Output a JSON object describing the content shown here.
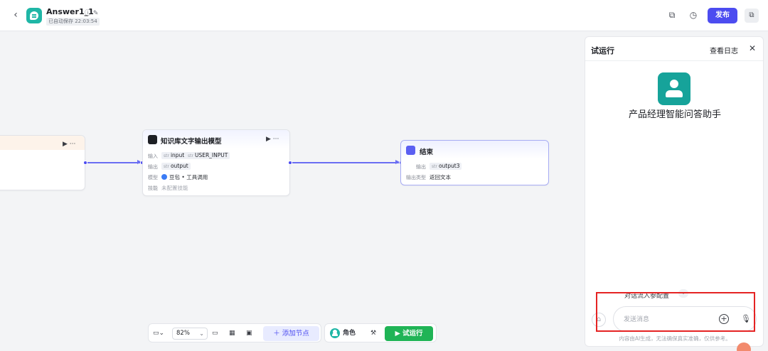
{
  "header": {
    "back_icon": "chevron-left-icon",
    "app_title": "Answer1_1",
    "title_icons": "ⓘ ✎",
    "saved_status": "已自动保存 22:03:54",
    "copy_icon": "copy-icon",
    "history_icon": "history-icon",
    "publish_label": "发布",
    "more_icon": "window-icon",
    "accent_color": "#4c4cf0"
  },
  "canvas": {
    "partial_node": {
      "controls": "▶ ···"
    },
    "kb_node": {
      "title": "知识库文字输出模型",
      "controls": "▶ ···",
      "input_label": "输入",
      "input_vars": [
        {
          "type": "str",
          "name": "input"
        },
        {
          "type": "str",
          "name": "USER_INPUT"
        }
      ],
      "output_label": "输出",
      "output_var": {
        "type": "str",
        "name": "output"
      },
      "model_label": "模型",
      "model_value": "豆包 • 工具调用",
      "skill_label": "技能",
      "skill_value": "未配置技能"
    },
    "end_node": {
      "title": "结束",
      "output_label": "输出",
      "output_var": {
        "type": "str",
        "name": "output3"
      },
      "output_type_label": "输出类型",
      "output_type_value": "返回文本"
    }
  },
  "toolbar": {
    "minimap_label": "▭⌄",
    "zoom_value": "82%",
    "comment_icon": "comment-icon",
    "grid_icon": "grid-icon",
    "image_icon": "image-icon",
    "add_node_label": "＋ 添加节点",
    "role_label": "角色",
    "wrench_icon": "wrench-icon",
    "run_label": "▶  试运行",
    "run_color": "#20b456"
  },
  "panel": {
    "title": "试运行",
    "view_log": "查看日志",
    "close_icon": "close-icon",
    "bot_name": "产品经理智能问答助手",
    "dialog_config": "对话流入参配置",
    "clear_icon": "broom-icon",
    "input_placeholder": "发送消息",
    "plus_icon": "plus-circle-icon",
    "mic_icon": "microphone-icon",
    "disclaimer": "内容由AI生成，无法确保真实准确，仅供参考。"
  }
}
